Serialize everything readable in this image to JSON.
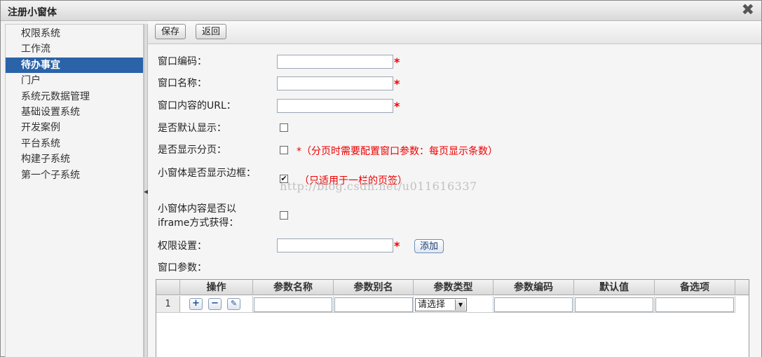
{
  "dialog": {
    "title": "注册小窗体",
    "close_glyph": "✖"
  },
  "sidebar": {
    "items": [
      {
        "label": "权限系统",
        "active": false
      },
      {
        "label": "工作流",
        "active": false
      },
      {
        "label": "待办事宜",
        "active": true
      },
      {
        "label": "门户",
        "active": false
      },
      {
        "label": "系统元数据管理",
        "active": false
      },
      {
        "label": "基础设置系统",
        "active": false
      },
      {
        "label": "开发案例",
        "active": false
      },
      {
        "label": "平台系统",
        "active": false
      },
      {
        "label": "构建子系统",
        "active": false
      },
      {
        "label": "第一个子系统",
        "active": false
      }
    ],
    "collapse_glyph": "◀"
  },
  "toolbar": {
    "save_label": "保存",
    "back_label": "返回"
  },
  "form": {
    "window_code_label": "窗口编码：",
    "window_name_label": "窗口名称：",
    "window_url_label": "窗口内容的URL：",
    "default_show_label": "是否默认显示：",
    "paging_label": "是否显示分页：",
    "paging_note": "*（分页时需要配置窗口参数：每页显示条数）",
    "border_label": "小窗体是否显示边框：",
    "border_checked": true,
    "border_note": "（只适用于一栏的页签）",
    "iframe_label": "小窗体内容是否以iframe方式获得：",
    "permission_label": "权限设置：",
    "add_button_label": "添加",
    "params_label": "窗口参数：",
    "required_mark": "*",
    "check_glyph": "✔",
    "watermark": "http://blog.csdn.net/u011616337"
  },
  "params_grid": {
    "headers": [
      "操作",
      "参数名称",
      "参数别名",
      "参数类型",
      "参数编码",
      "默认值",
      "备选项"
    ],
    "rows": [
      {
        "num": "1",
        "type_select": "请选择"
      }
    ],
    "add_glyph": "+",
    "remove_glyph": "−",
    "edit_glyph": "✎",
    "select_arrow": "▼"
  }
}
